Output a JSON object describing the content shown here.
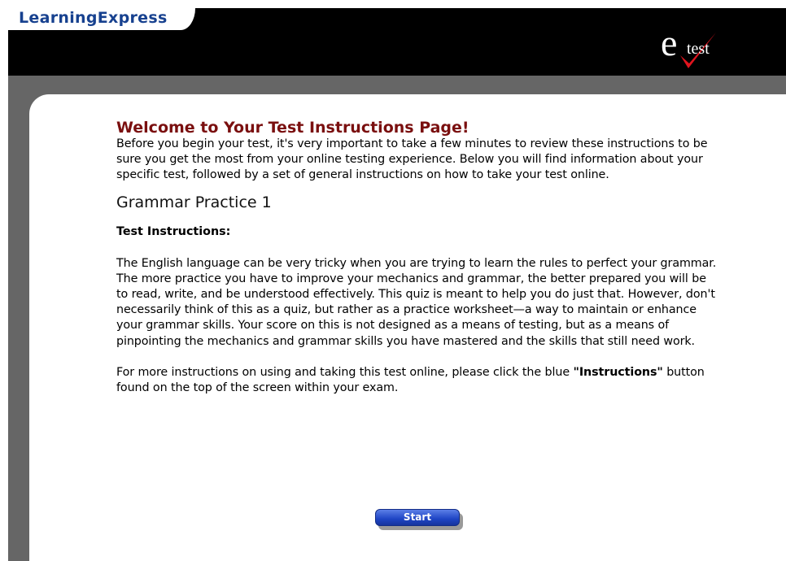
{
  "header": {
    "brand": "LearningExpress",
    "logo_e": "e",
    "logo_test": "test",
    "logo_check_color": "#e0141e"
  },
  "main": {
    "title": "Welcome to Your Test Instructions Page!",
    "intro": "Before you begin your test, it's very important to take a few minutes to review these instructions to be sure you get the most from your online testing experience. Below you will find information about your specific test, followed by a set of general instructions on how to take your test online.",
    "test_name": "Grammar Practice 1",
    "instructions_label": "Test Instructions:",
    "instructions_body": "The English language can be very tricky when you are trying to learn the rules to perfect your grammar. The more practice you have to improve your mechanics and grammar, the better prepared you will be to read, write, and be understood effectively. This quiz is meant to help you do just that. However, don't necessarily think of this as a quiz, but rather as a practice worksheet—a way to maintain or enhance your grammar skills. Your score on this is not designed as a means of testing, but as a means of pinpointing the mechanics and grammar skills you have mastered and the skills that still need work.",
    "more_before": "For more instructions on using and taking this test online, please click the blue ",
    "more_bold": "\"Instructions\"",
    "more_after": " button found on the top of the screen within your exam.",
    "start_label": "Start"
  },
  "colors": {
    "title": "#7a0f0f",
    "brand": "#17418f",
    "header_bg": "#000000",
    "frame": "#666666",
    "button": "#1e44c4"
  }
}
